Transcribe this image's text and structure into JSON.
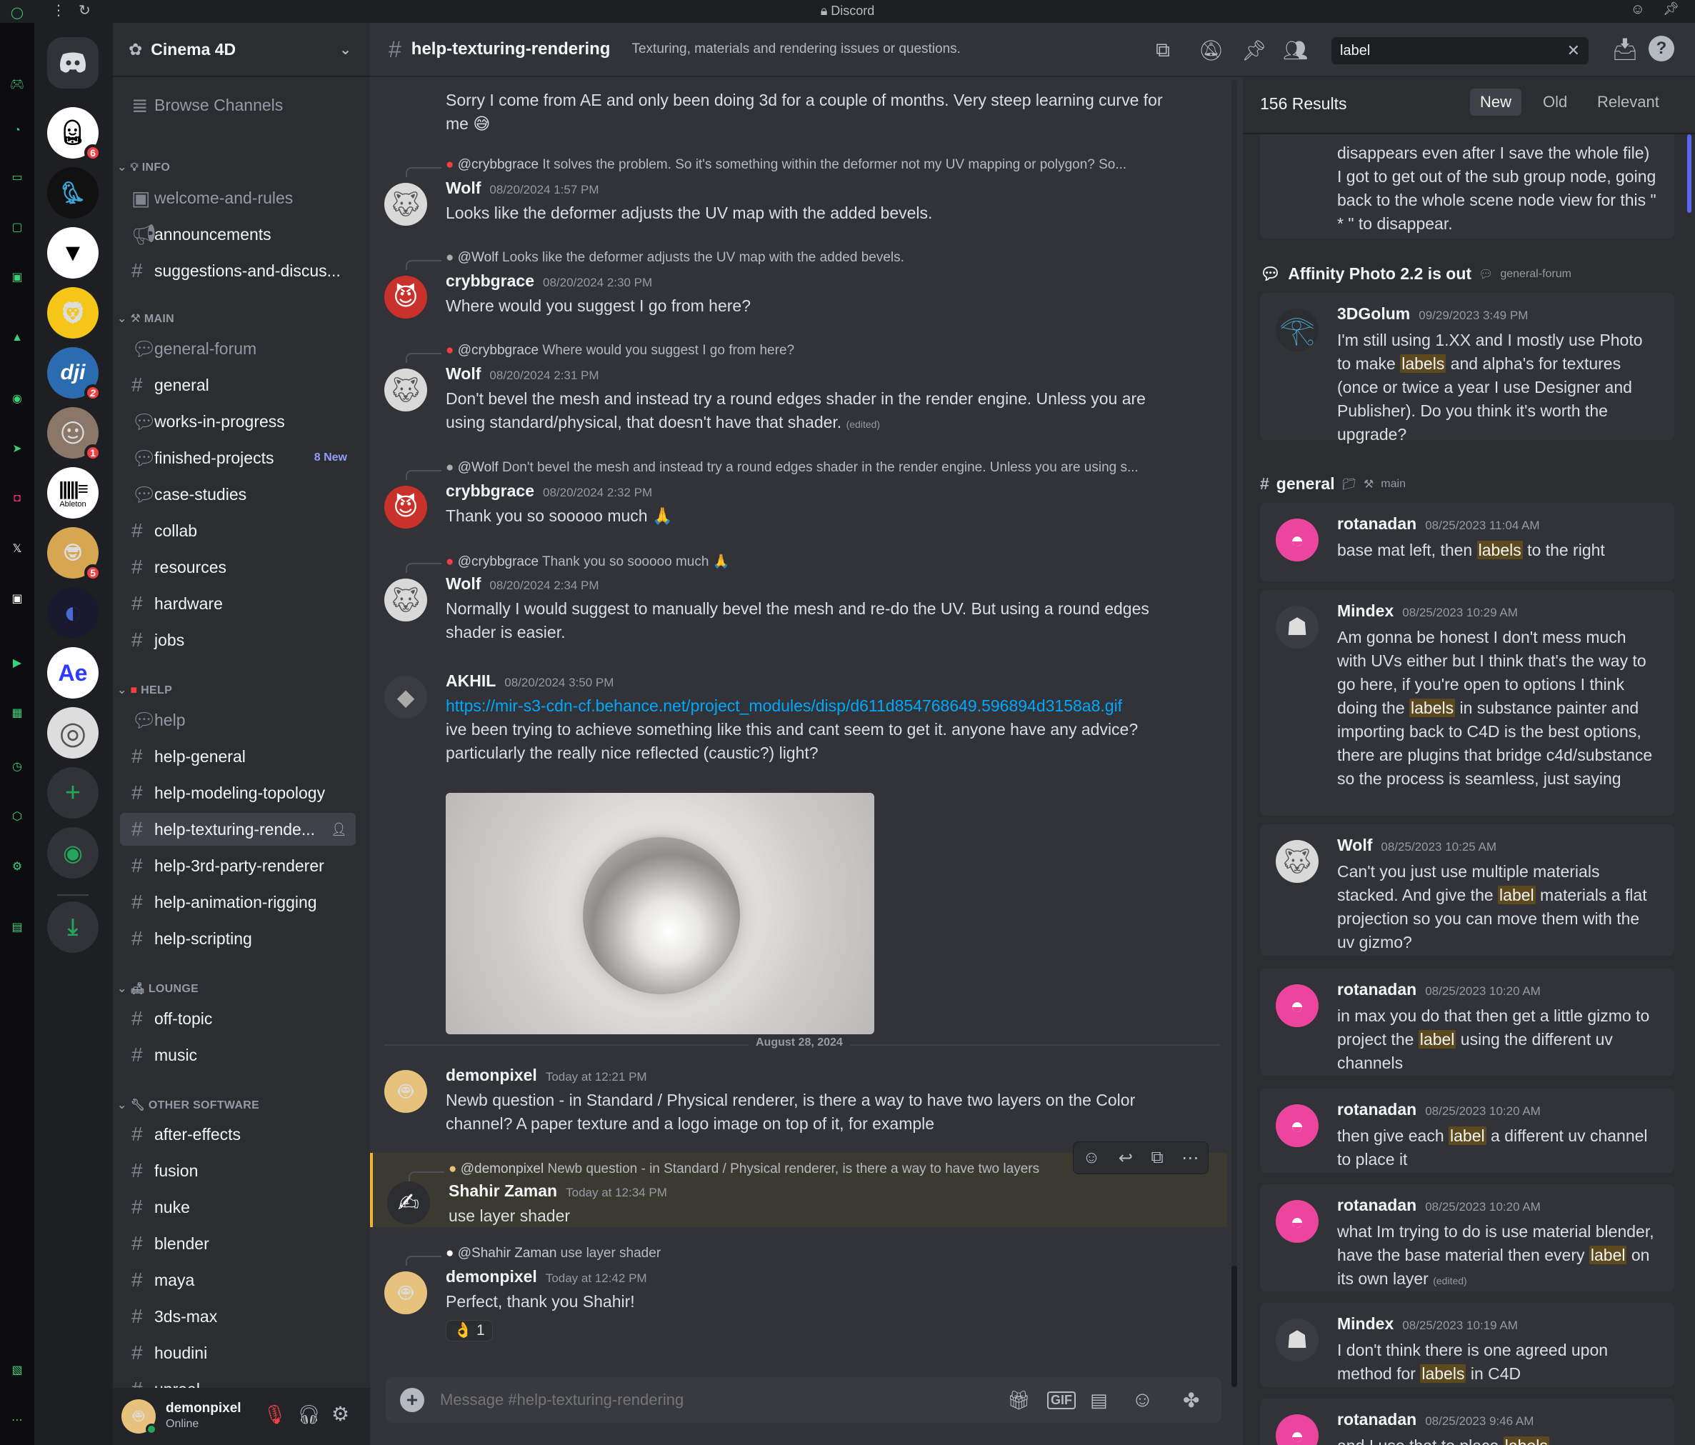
{
  "window": {
    "title": "Discord"
  },
  "guild": {
    "name": "Cinema 4D",
    "browse": "Browse Channels"
  },
  "categories": {
    "info": "INFO",
    "main": "MAIN",
    "help": "HELP",
    "lounge": "LOUNGE",
    "other": "OTHER SOFTWARE"
  },
  "channels": {
    "c1": "welcome-and-rules",
    "c2": "announcements",
    "c3": "suggestions-and-discus...",
    "c4": "general-forum",
    "c5": "general",
    "c6": "works-in-progress",
    "c7": "finished-projects",
    "c7_new": "8 New",
    "c8": "case-studies",
    "c9": "collab",
    "c10": "resources",
    "c11": "hardware",
    "c12": "jobs",
    "c13": "help",
    "c14": "help-general",
    "c15": "help-modeling-topology",
    "c16": "help-texturing-rende...",
    "c17": "help-3rd-party-renderer",
    "c18": "help-animation-rigging",
    "c19": "help-scripting",
    "c20": "off-topic",
    "c21": "music",
    "c22": "after-effects",
    "c23": "fusion",
    "c24": "nuke",
    "c25": "blender",
    "c26": "maya",
    "c27": "3ds-max",
    "c28": "houdini",
    "c29": "unreal"
  },
  "servers": {
    "s_badge1": "6",
    "s_badge2": "2",
    "s_badge3": "1",
    "s_badge4": "5",
    "ableton": "Ableton",
    "ae": "Ae"
  },
  "user": {
    "name": "demonpixel",
    "status": "Online"
  },
  "chat": {
    "channel": "help-texturing-rendering",
    "topic": "Texturing, materials and rendering issues or questions.",
    "composer_placeholder": "Message #help-texturing-rendering",
    "date_divider": "August 28, 2024"
  },
  "messages": {
    "m0_body": "Sorry I come from AE and only been doing 3d for a couple of months. Very steep learning curve for me 😅",
    "m1_reply_user": "@crybbgrace",
    "m1_reply": "It solves the problem. So it's something within the deformer not my UV mapping or polygon? So...",
    "m1_author": "Wolf",
    "m1_ts": "08/20/2024 1:57 PM",
    "m1_body": "Looks like the deformer adjusts the UV map with the added bevels.",
    "m2_reply_user": "@Wolf",
    "m2_reply": "Looks like the deformer adjusts the UV map with the added bevels.",
    "m2_author": "crybbgrace",
    "m2_ts": "08/20/2024 2:30 PM",
    "m2_body": "Where would you suggest I go from here?",
    "m3_reply_user": "@crybbgrace",
    "m3_reply": "Where would you suggest I go from here?",
    "m3_author": "Wolf",
    "m3_ts": "08/20/2024 2:31 PM",
    "m3_body": "Don't bevel the mesh and instead try a round edges shader in the render engine. Unless you are using standard/physical, that doesn't have that shader.",
    "edited": "(edited)",
    "m4_reply_user": "@Wolf",
    "m4_reply": "Don't bevel the mesh and instead try a round edges shader in the render engine. Unless you are using s...",
    "m4_author": "crybbgrace",
    "m4_ts": "08/20/2024 2:32 PM",
    "m4_body": "Thank you so sooooo much 🙏",
    "m5_reply_user": "@crybbgrace",
    "m5_reply": "Thank you so sooooo much 🙏",
    "m5_author": "Wolf",
    "m5_ts": "08/20/2024 2:34 PM",
    "m5_body": "Normally I would suggest to manually bevel the mesh and re-do the UV. But using a round edges shader is easier.",
    "m6_author": "AKHIL",
    "m6_ts": "08/20/2024 3:50 PM",
    "m6_link": "https://mir-s3-cdn-cf.behance.net/project_modules/disp/d611d854768649.596894d3158a8.gif",
    "m6_body": "ive been trying to achieve something like this and cant seem to get it. anyone have any advice? particularly the really nice reflected (caustic?) light?",
    "m7_author": "demonpixel",
    "m7_ts": "Today at 12:21 PM",
    "m7_body": "Newb question - in Standard / Physical renderer, is there a way to have two layers on the Color channel? A paper texture and a logo image on top of it, for example",
    "m8_reply_user": "@demonpixel",
    "m8_reply": "Newb question - in Standard / Physical renderer, is there a way to have two layers",
    "m8_author": "Shahir Zaman",
    "m8_ts": "Today at 12:34 PM",
    "m8_body": "use layer shader",
    "m9_reply_user": "@Shahir Zaman",
    "m9_reply": "use layer shader",
    "m9_author": "demonpixel",
    "m9_ts": "Today at 12:42 PM",
    "m9_body": "Perfect, thank you Shahir!",
    "m9_reaction": "👌 1"
  },
  "search": {
    "query": "label",
    "count": "156 Results",
    "tabs": {
      "new": "New",
      "old": "Old",
      "relevant": "Relevant"
    },
    "r0_body": "disappears even after I save the whole file) I got to get out of the sub group node, going back to the whole scene node view for this \" * \" to disappear.",
    "g1_title": "Affinity Photo 2.2 is out",
    "g1_sub": "general-forum",
    "r1_author": "3DGolum",
    "r1_ts": "09/29/2023 3:49 PM",
    "g2_title": "general",
    "g2_sub": "main",
    "r2_author": "rotanadan",
    "r2_ts": "08/25/2023 11:04 AM",
    "r3_author": "Mindex",
    "r3_ts": "08/25/2023 10:29 AM",
    "r4_author": "Wolf",
    "r4_ts": "08/25/2023 10:25 AM",
    "r5_author": "rotanadan",
    "r5_ts": "08/25/2023 10:20 AM",
    "r6_author": "rotanadan",
    "r6_ts": "08/25/2023 10:20 AM",
    "r7_author": "rotanadan",
    "r7_ts": "08/25/2023 10:20 AM",
    "r8_author": "Mindex",
    "r8_ts": "08/25/2023 10:19 AM",
    "r9_author": "rotanadan",
    "r9_ts": "08/25/2023 9:46 AM",
    "hl_label": "label",
    "hl_labels": "labels",
    "t_r1a": "I'm still using 1.XX and I mostly use Photo to make ",
    "t_r1b": " and alpha's for textures (once or twice a year I use Designer and Publisher). Do you think it's worth the upgrade?",
    "t_r2a": "base mat left, then ",
    "t_r2b": " to the right",
    "t_r3a": "Am gonna be honest I don't mess much with UVs either but I think that's the way to go here, if you're open to options I think doing the ",
    "t_r3b": " in substance painter and importing back to C4D is the best options, there are plugins that bridge c4d/substance so the process is seamless, just saying",
    "t_r4a": "Can't you just use multiple materials stacked. And give the ",
    "t_r4b": " materials a flat projection so you can move them with the uv gizmo?",
    "t_r5a": "in max you do that then get a little gizmo to project the ",
    "t_r5b": " using the different uv channels",
    "t_r6a": "then give each ",
    "t_r6b": " a different uv channel to place it",
    "t_r7a": "what Im trying to do is use material blender, have the base material then every ",
    "t_r7b": " on its own  layer ",
    "t_r8a": "I don't think there is one agreed upon method for ",
    "t_r8b": " in C4D",
    "t_r9a": "and I use that to place "
  },
  "colors": {
    "accent": "#5865f2",
    "highlight": "#5c4a1e",
    "link": "#00a8fc",
    "red": "#f23f43",
    "green": "#23a55a"
  }
}
